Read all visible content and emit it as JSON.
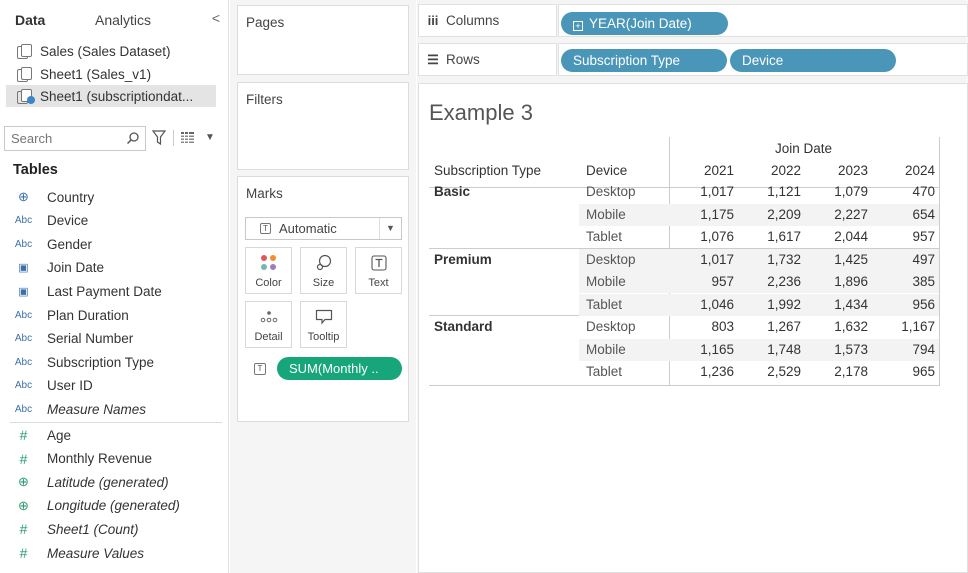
{
  "data_pane": {
    "tabs": [
      "Data",
      "Analytics"
    ],
    "collapse_glyph": "<",
    "datasources": [
      "Sales (Sales Dataset)",
      "Sheet1 (Sales_v1)",
      "Sheet1 (subscriptiondat..."
    ],
    "search_placeholder": "Search",
    "tables_heading": "Tables",
    "fields": [
      {
        "icon": "globe-icon",
        "type": "geo",
        "label": "Country"
      },
      {
        "icon": "abc-icon",
        "type": "Abc",
        "label": "Device"
      },
      {
        "icon": "abc-icon",
        "type": "Abc",
        "label": "Gender"
      },
      {
        "icon": "calendar-icon",
        "type": "date",
        "label": "Join Date"
      },
      {
        "icon": "calendar-icon",
        "type": "date",
        "label": "Last Payment Date"
      },
      {
        "icon": "abc-icon",
        "type": "Abc",
        "label": "Plan Duration"
      },
      {
        "icon": "abc-icon",
        "type": "Abc",
        "label": "Serial Number"
      },
      {
        "icon": "abc-icon",
        "type": "Abc",
        "label": "Subscription Type"
      },
      {
        "icon": "abc-icon",
        "type": "Abc",
        "label": "User ID"
      },
      {
        "icon": "abc-icon",
        "type": "Abc",
        "label": "Measure Names",
        "italic": true
      }
    ],
    "measures": [
      {
        "icon": "hash-icon",
        "type": "#",
        "label": "Age"
      },
      {
        "icon": "hash-icon",
        "type": "#",
        "label": "Monthly Revenue"
      },
      {
        "icon": "globe-icon",
        "type": "geo",
        "label": "Latitude (generated)",
        "italic": true
      },
      {
        "icon": "globe-icon",
        "type": "geo",
        "label": "Longitude (generated)",
        "italic": true
      },
      {
        "icon": "hash-icon",
        "type": "#",
        "label": "Sheet1 (Count)",
        "italic": true
      },
      {
        "icon": "hash-icon",
        "type": "#",
        "label": "Measure Values",
        "italic": true
      }
    ]
  },
  "cards": {
    "pages": "Pages",
    "filters": "Filters",
    "marks": "Marks",
    "mark_type": "Automatic",
    "mark_buttons": [
      "Color",
      "Size",
      "Text",
      "Detail",
      "Tooltip"
    ],
    "measure_pill": "SUM(Monthly .."
  },
  "shelves": {
    "columns_label": "Columns",
    "rows_label": "Rows",
    "columns_pills": [
      "YEAR(Join Date)"
    ],
    "rows_pills": [
      "Subscription Type",
      "Device"
    ]
  },
  "viz": {
    "title": "Example 3",
    "header": {
      "group": "Join Date",
      "row_headers": [
        "Subscription Type",
        "Device"
      ],
      "years": [
        "2021",
        "2022",
        "2023",
        "2024"
      ]
    },
    "groups": [
      {
        "name": "Basic",
        "rows": [
          {
            "device": "Desktop",
            "values": [
              "1,017",
              "1,121",
              "1,079",
              "470"
            ]
          },
          {
            "device": "Mobile",
            "values": [
              "1,175",
              "2,209",
              "2,227",
              "654"
            ]
          },
          {
            "device": "Tablet",
            "values": [
              "1,076",
              "1,617",
              "2,044",
              "957"
            ]
          }
        ]
      },
      {
        "name": "Premium",
        "rows": [
          {
            "device": "Desktop",
            "values": [
              "1,017",
              "1,732",
              "1,425",
              "497"
            ]
          },
          {
            "device": "Mobile",
            "values": [
              "957",
              "2,236",
              "1,896",
              "385"
            ]
          },
          {
            "device": "Tablet",
            "values": [
              "1,046",
              "1,992",
              "1,434",
              "956"
            ]
          }
        ]
      },
      {
        "name": "Standard",
        "rows": [
          {
            "device": "Desktop",
            "values": [
              "803",
              "1,267",
              "1,632",
              "1,167"
            ]
          },
          {
            "device": "Mobile",
            "values": [
              "1,165",
              "1,748",
              "1,573",
              "794"
            ]
          },
          {
            "device": "Tablet",
            "values": [
              "1,236",
              "2,529",
              "2,178",
              "965"
            ]
          }
        ]
      }
    ]
  }
}
